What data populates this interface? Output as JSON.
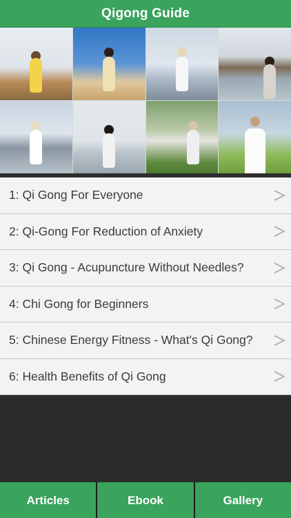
{
  "header": {
    "title": "Qigong Guide"
  },
  "gallery": {
    "photos": [
      "photo-1",
      "photo-2",
      "photo-3",
      "photo-4",
      "photo-5",
      "photo-6",
      "photo-7",
      "photo-8"
    ]
  },
  "articles": [
    {
      "label": "1: Qi Gong For Everyone"
    },
    {
      "label": "2: Qi-Gong For Reduction of Anxiety"
    },
    {
      "label": "3: Qi Gong - Acupuncture Without Needles?"
    },
    {
      "label": "4: Chi Gong for Beginners"
    },
    {
      "label": "5: Chinese Energy Fitness - What's Qi Gong?"
    },
    {
      "label": "6: Health Benefits of Qi Gong"
    }
  ],
  "tabs": {
    "articles": "Articles",
    "ebook": "Ebook",
    "gallery": "Gallery"
  },
  "colors": {
    "accent": "#3aa35c",
    "list_bg": "#f2f3f4",
    "text": "#3b3b3b",
    "dark_bg": "#2b2b2b"
  },
  "icons": {
    "chevron": "chevron-right-icon"
  }
}
